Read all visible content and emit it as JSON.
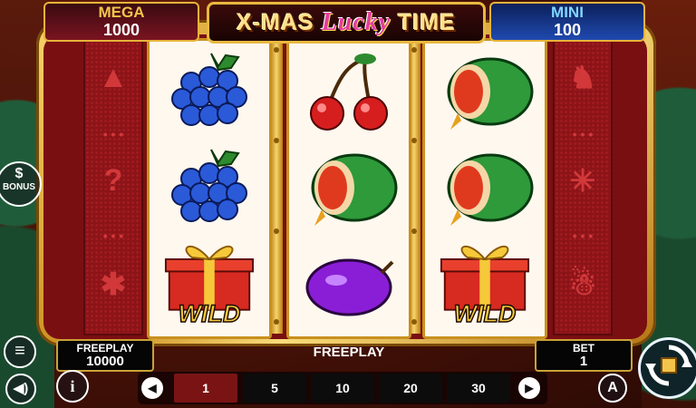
{
  "jackpots": {
    "mega": {
      "label": "MEGA",
      "value": "1000"
    },
    "mini": {
      "label": "MINI",
      "value": "100"
    }
  },
  "logo": {
    "part1": "X-MAS ",
    "lucky": "Lucky",
    "part2": " TIME"
  },
  "reels": [
    [
      "grapes-icon",
      "grapes-icon",
      "wild-gift-icon"
    ],
    [
      "cherries-icon",
      "watermelon-icon",
      "plum-icon"
    ],
    [
      "watermelon-icon",
      "watermelon-icon",
      "wild-gift-icon"
    ]
  ],
  "wild_label": "WILD",
  "freeplay_box": {
    "label": "FREEPLAY",
    "value": "10000"
  },
  "bet_box": {
    "label": "BET",
    "value": "1"
  },
  "status_text": "FREEPLAY",
  "bet_options": [
    "1",
    "5",
    "10",
    "20",
    "30"
  ],
  "selected_bet": "1",
  "buttons": {
    "bonus": "BONUS",
    "auto": "A",
    "info": "i"
  },
  "colors": {
    "accent_gold": "#e9b840",
    "reel_bg": "#fff8ee",
    "selected_bet": "#7a1414",
    "mega_bg": "#7a1420",
    "mini_bg": "#1f4ab0"
  }
}
